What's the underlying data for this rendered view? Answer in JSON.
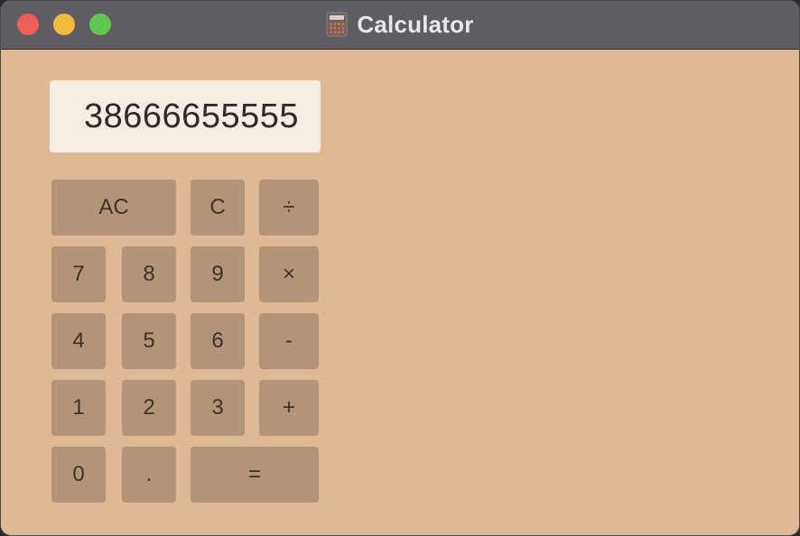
{
  "window": {
    "title": "Calculator",
    "icon": "calculator-icon",
    "controls": [
      "close",
      "minimize",
      "zoom"
    ]
  },
  "display": {
    "value": "38666655555"
  },
  "keys": {
    "ac": "AC",
    "c": "C",
    "divide": "÷",
    "seven": "7",
    "eight": "8",
    "nine": "9",
    "multiply": "×",
    "four": "4",
    "five": "5",
    "six": "6",
    "minus": "-",
    "one": "1",
    "two": "2",
    "three": "3",
    "plus": "+",
    "zero": "0",
    "dot": ".",
    "equals": "="
  },
  "colors": {
    "background": "#dfb894",
    "titlebar": "#5f5c63",
    "display": "#f5ece4",
    "key": "#b29478",
    "close": "#ee5d58",
    "minimize": "#f3bc3f",
    "zoom": "#5fc750"
  }
}
